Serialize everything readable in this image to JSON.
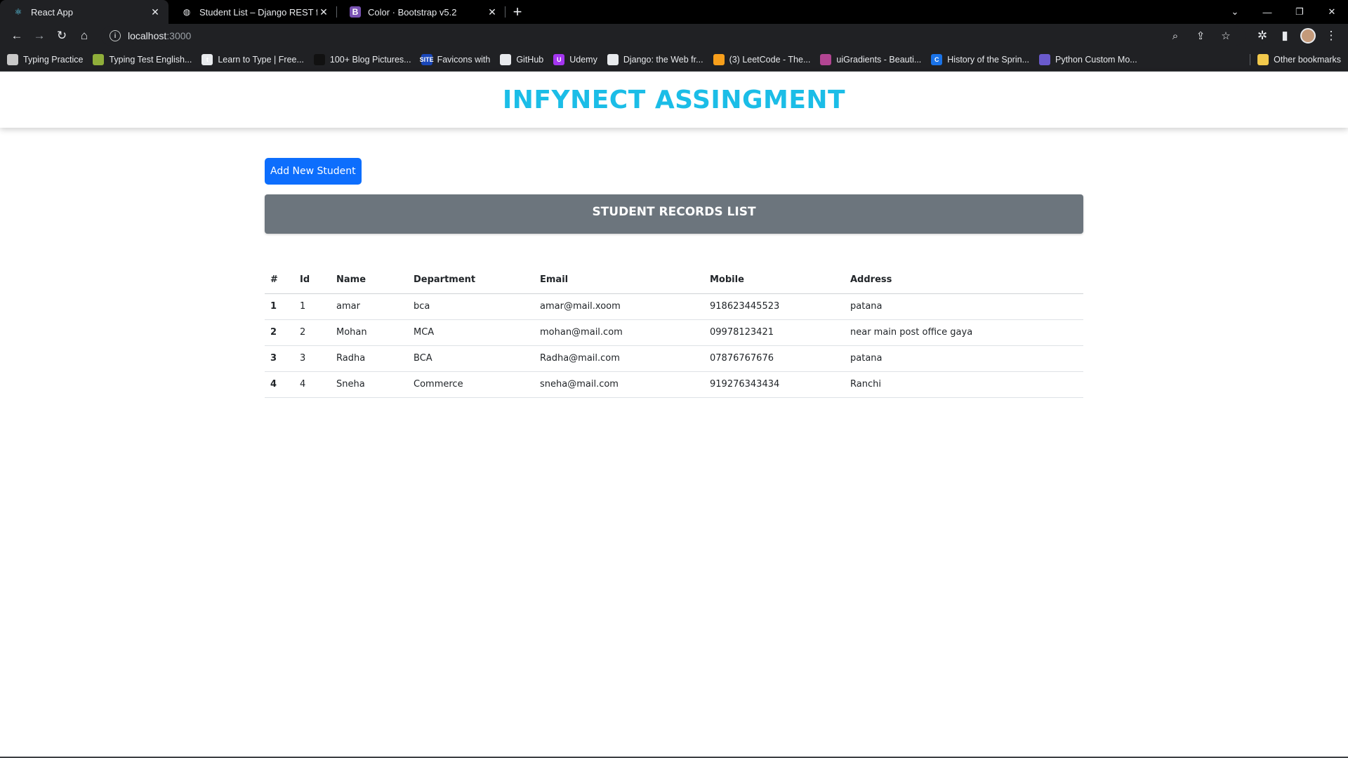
{
  "browser": {
    "tabs": [
      {
        "title": "React App",
        "icon": "react-icon",
        "active": true
      },
      {
        "title": "Student List – Django REST framework",
        "icon": "globe-icon",
        "active": false
      },
      {
        "title": "Color · Bootstrap v5.2",
        "icon": "bootstrap-icon",
        "active": false
      }
    ],
    "url_host": "localhost",
    "url_port": ":3000",
    "bookmarks": [
      {
        "label": "Typing Practice",
        "icon_text": "",
        "color": "#c8c8c8"
      },
      {
        "label": "Typing Test English...",
        "icon_text": "",
        "color": "#8fae3a"
      },
      {
        "label": "Learn to Type | Free...",
        "icon_text": "t",
        "color": "#e8eaed"
      },
      {
        "label": "100+ Blog Pictures...",
        "icon_text": "",
        "color": "#111111"
      },
      {
        "label": "Favicons with",
        "icon_text": "SITE",
        "color": "#1a47b8"
      },
      {
        "label": "GitHub",
        "icon_text": "",
        "color": "#e8eaed"
      },
      {
        "label": "Udemy",
        "icon_text": "U",
        "color": "#a435f0"
      },
      {
        "label": "Django: the Web fr...",
        "icon_text": "",
        "color": "#e8eaed"
      },
      {
        "label": "(3) LeetCode - The...",
        "icon_text": "",
        "color": "#f89f1b"
      },
      {
        "label": "uiGradients - Beauti...",
        "icon_text": "",
        "color": "#b24592"
      },
      {
        "label": "History of the Sprin...",
        "icon_text": "C",
        "color": "#1a73e8"
      },
      {
        "label": "Python Custom Mo...",
        "icon_text": "",
        "color": "#6a5acd"
      }
    ],
    "other_bookmarks": "Other bookmarks"
  },
  "app": {
    "title": "INFYNECT ASSINGMENT",
    "add_button": "Add New Student",
    "records_title": "STUDENT RECORDS LIST",
    "columns": [
      "#",
      "Id",
      "Name",
      "Department",
      "Email",
      "Mobile",
      "Address"
    ],
    "rows": [
      [
        "1",
        "1",
        "amar",
        "bca",
        "amar@mail.xoom",
        "918623445523",
        "patana"
      ],
      [
        "2",
        "2",
        "Mohan",
        "MCA",
        "mohan@mail.com",
        "09978123421",
        "near main post office gaya"
      ],
      [
        "3",
        "3",
        "Radha",
        "BCA",
        "Radha@mail.com",
        "07876767676",
        "patana"
      ],
      [
        "4",
        "4",
        "Sneha",
        "Commerce",
        "sneha@mail.com",
        "919276343434",
        "Ranchi"
      ]
    ]
  },
  "colors": {
    "title": "#1bbde7",
    "button": "#0d6efd",
    "records_bar": "#6c757d"
  }
}
